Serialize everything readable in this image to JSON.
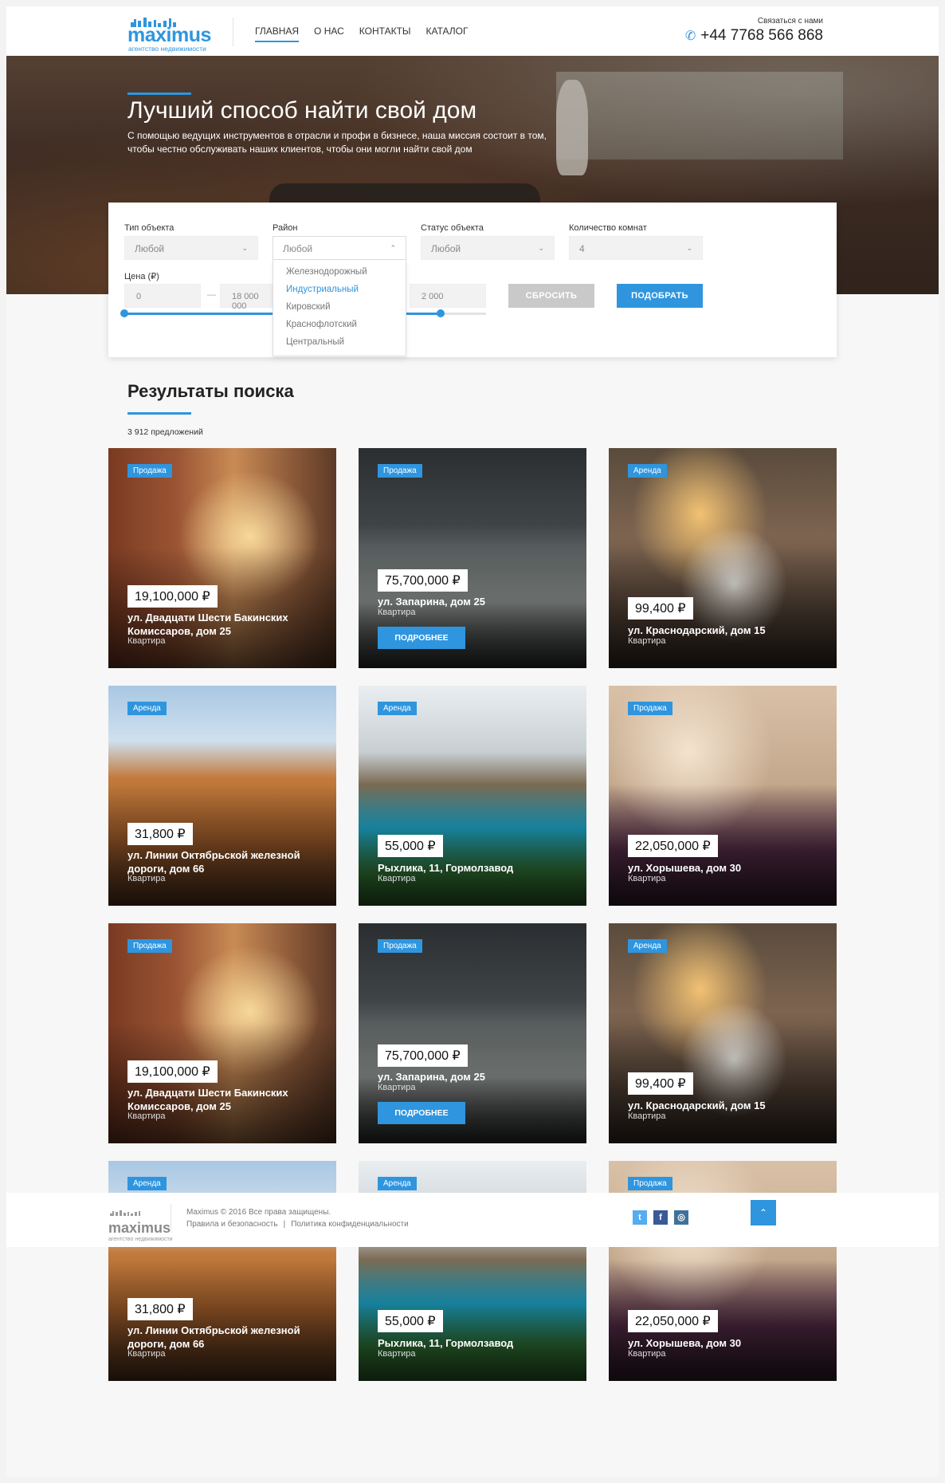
{
  "header": {
    "logo_word": "maximus",
    "logo_sub": "агентство недвижимости",
    "nav": [
      {
        "label": "Главная"
      },
      {
        "label": "О нас"
      },
      {
        "label": "Контакты"
      },
      {
        "label": "Каталог"
      }
    ],
    "contact_label": "Связаться с нами",
    "phone": "+44 7768 566 868"
  },
  "hero": {
    "title": "Лучший способ найти свой дом",
    "text": "С помощью ведущих инструментов в отрасли и профи в бизнесе, наша миссия состоит в том, чтобы честно обслуживать наших клиентов, чтобы они могли найти свой дом"
  },
  "search": {
    "type_label": "Тип объекта",
    "type_value": "Любой",
    "district_label": "Район",
    "district_value": "Любой",
    "district_options": [
      "Железнодорожный",
      "Индустриальный",
      "Кировский",
      "Краснофлотский",
      "Центральный"
    ],
    "district_highlighted": "Индустриальный",
    "status_label": "Статус объекта",
    "status_value": "Любой",
    "rooms_label": "Количество комнат",
    "rooms_value": "4",
    "price_label": "Цена (₽)",
    "price_min": "0",
    "price_sep": "—",
    "price_max": "18 000 000",
    "area_max": "2 000",
    "reset_label": "Сбросить",
    "submit_label": "Подобрать"
  },
  "results": {
    "title": "Результаты поиска",
    "count": "3 912 предложений",
    "more_label": "Подробнее",
    "cards": [
      {
        "badge": "Продажа",
        "price": "19,100,000 ₽",
        "address": "ул. Двадцати Шести Бакинских Комиссаров, дом 25",
        "type": "Квартира",
        "theme": "living"
      },
      {
        "badge": "Продажа",
        "price": "75,700,000 ₽",
        "address": "ул. Запарина, дом 25",
        "type": "Квартира",
        "theme": "modern",
        "hover": true
      },
      {
        "badge": "Аренда",
        "price": "99,400 ₽",
        "address": "ул. Краснодарский, дом 15",
        "type": "Квартира",
        "theme": "bedroom"
      },
      {
        "badge": "Аренда",
        "price": "31,800 ₽",
        "address": "ул. Линии Октябрьской железной дороги, дом 66",
        "type": "Квартира",
        "theme": "wood"
      },
      {
        "badge": "Аренда",
        "price": "55,000 ₽",
        "address": "Рыхлика, 11, Гормолзавод",
        "type": "Квартира",
        "theme": "pool"
      },
      {
        "badge": "Продажа",
        "price": "22,050,000 ₽",
        "address": "ул. Хорышева, дом 30",
        "type": "Квартира",
        "theme": "purple"
      },
      {
        "badge": "Продажа",
        "price": "19,100,000 ₽",
        "address": "ул. Двадцати Шести Бакинских Комиссаров, дом 25",
        "type": "Квартира",
        "theme": "living"
      },
      {
        "badge": "Продажа",
        "price": "75,700,000 ₽",
        "address": "ул. Запарина, дом 25",
        "type": "Квартира",
        "theme": "modern",
        "hover": true
      },
      {
        "badge": "Аренда",
        "price": "99,400 ₽",
        "address": "ул. Краснодарский, дом 15",
        "type": "Квартира",
        "theme": "bedroom"
      },
      {
        "badge": "Аренда",
        "price": "31,800 ₽",
        "address": "ул. Линии Октябрьской железной дороги, дом 66",
        "type": "Квартира",
        "theme": "wood"
      },
      {
        "badge": "Аренда",
        "price": "55,000 ₽",
        "address": "Рыхлика, 11, Гормолзавод",
        "type": "Квартира",
        "theme": "pool"
      },
      {
        "badge": "Продажа",
        "price": "22,050,000 ₽",
        "address": "ул. Хорышева, дом 30",
        "type": "Квартира",
        "theme": "purple"
      }
    ]
  },
  "footer": {
    "logo_word": "maximus",
    "logo_sub": "агентство недвижимости",
    "copyright": "Maximus © 2016 Все права защищены.",
    "links": [
      "Правила и безопасность",
      "Политика конфиденциальности"
    ],
    "link_sep": "|",
    "social": [
      {
        "icon": "twitter-icon",
        "glyph": "t",
        "color": "#55acee"
      },
      {
        "icon": "facebook-icon",
        "glyph": "f",
        "color": "#3b5998"
      },
      {
        "icon": "instagram-icon",
        "glyph": "◎",
        "color": "#3f729b"
      }
    ],
    "to_top_icon": "chevron-up-icon"
  },
  "colors": {
    "accent": "#2f95de"
  }
}
